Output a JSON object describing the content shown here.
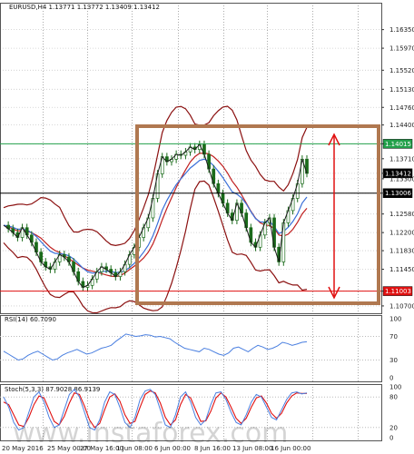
{
  "chart_data": {
    "type": "line",
    "symbol_header": "EURUSD,H4  1.13771 1.13772 1.13409 1.13412",
    "price_axis": {
      "ylim": [
        1.1055,
        1.169
      ],
      "ticks": [
        "1.16350",
        "1.15970",
        "1.15520",
        "1.15130",
        "1.14760",
        "1.14400",
        "1.14015",
        "1.13710",
        "1.13412",
        "1.13300",
        "1.13006",
        "1.12580",
        "1.12200",
        "1.11830",
        "1.11450",
        "1.11003",
        "1.10700"
      ]
    },
    "levels": [
      {
        "value": 1.14015,
        "label": "1.14015",
        "color": "#22a04a"
      },
      {
        "value": 1.13006,
        "label": "1.13006",
        "color": "#000000"
      },
      {
        "value": 1.11003,
        "label": "1.11003",
        "color": "#e01010"
      },
      {
        "value": 1.13412,
        "label": "1.13412",
        "color": "#000000"
      }
    ],
    "price_series": [
      1.1235,
      1.1228,
      1.122,
      1.121,
      1.123,
      1.1215,
      1.12,
      1.118,
      1.116,
      1.115,
      1.1145,
      1.116,
      1.1175,
      1.117,
      1.116,
      1.114,
      1.112,
      1.1108,
      1.1112,
      1.1125,
      1.114,
      1.115,
      1.1145,
      1.1138,
      1.113,
      1.114,
      1.1155,
      1.1175,
      1.119,
      1.121,
      1.123,
      1.125,
      1.129,
      1.134,
      1.1375,
      1.1365,
      1.137,
      1.138,
      1.1378,
      1.1385,
      1.1395,
      1.139,
      1.14,
      1.138,
      1.135,
      1.132,
      1.13,
      1.128,
      1.126,
      1.1245,
      1.128,
      1.126,
      1.123,
      1.12,
      1.119,
      1.1215,
      1.124,
      1.125,
      1.119,
      1.116,
      1.124,
      1.1265,
      1.129,
      1.132,
      1.137,
      1.1341
    ],
    "rsi": {
      "label": "RSI(14) 60.7090",
      "ylim": [
        0,
        100
      ],
      "ticks": [
        "100",
        "70",
        "30",
        "0"
      ],
      "values": [
        45,
        40,
        35,
        30,
        32,
        38,
        42,
        45,
        40,
        35,
        30,
        32,
        38,
        42,
        45,
        48,
        44,
        40,
        42,
        46,
        50,
        52,
        55,
        62,
        68,
        74,
        72,
        70,
        71,
        73,
        72,
        69,
        70,
        68,
        66,
        60,
        55,
        50,
        48,
        46,
        44,
        50,
        48,
        44,
        40,
        38,
        42,
        50,
        52,
        48,
        44,
        50,
        55,
        52,
        48,
        50,
        54,
        60,
        58,
        55,
        57,
        60,
        61
      ]
    },
    "stochastic": {
      "label": "Stoch(5,3,3) 87.9028 86.9139",
      "ylim": [
        0,
        100
      ],
      "ticks": [
        "100",
        "80",
        "20",
        "0"
      ],
      "k_values": [
        80,
        60,
        30,
        15,
        20,
        50,
        80,
        90,
        70,
        40,
        20,
        25,
        55,
        85,
        95,
        80,
        50,
        20,
        15,
        35,
        70,
        90,
        85,
        60,
        30,
        20,
        40,
        75,
        92,
        95,
        85,
        55,
        25,
        20,
        45,
        80,
        90,
        70,
        40,
        25,
        35,
        65,
        88,
        90,
        75,
        50,
        30,
        25,
        45,
        70,
        85,
        80,
        60,
        40,
        35,
        55,
        75,
        88,
        90,
        86,
        88
      ],
      "d_values": [
        70,
        65,
        45,
        25,
        22,
        40,
        65,
        82,
        78,
        55,
        32,
        25,
        42,
        68,
        88,
        85,
        62,
        35,
        20,
        28,
        55,
        80,
        86,
        72,
        45,
        28,
        32,
        60,
        85,
        92,
        88,
        68,
        40,
        25,
        35,
        65,
        85,
        78,
        55,
        32,
        33,
        52,
        78,
        88,
        80,
        60,
        38,
        28,
        38,
        60,
        78,
        82,
        68,
        48,
        38,
        48,
        68,
        82,
        88,
        87,
        87
      ]
    },
    "time_axis": [
      "20 May 2016",
      "25 May 00:00",
      "27 May 16:00",
      "1 Jun 08:00",
      "6 Jun 00:00",
      "8 Jun 16:00",
      "13 Jun 08:00",
      "16 Jun 00:00"
    ],
    "annotation": {
      "type": "rectangle",
      "color": "#b07850"
    },
    "watermark": "www.instaforex.com"
  }
}
